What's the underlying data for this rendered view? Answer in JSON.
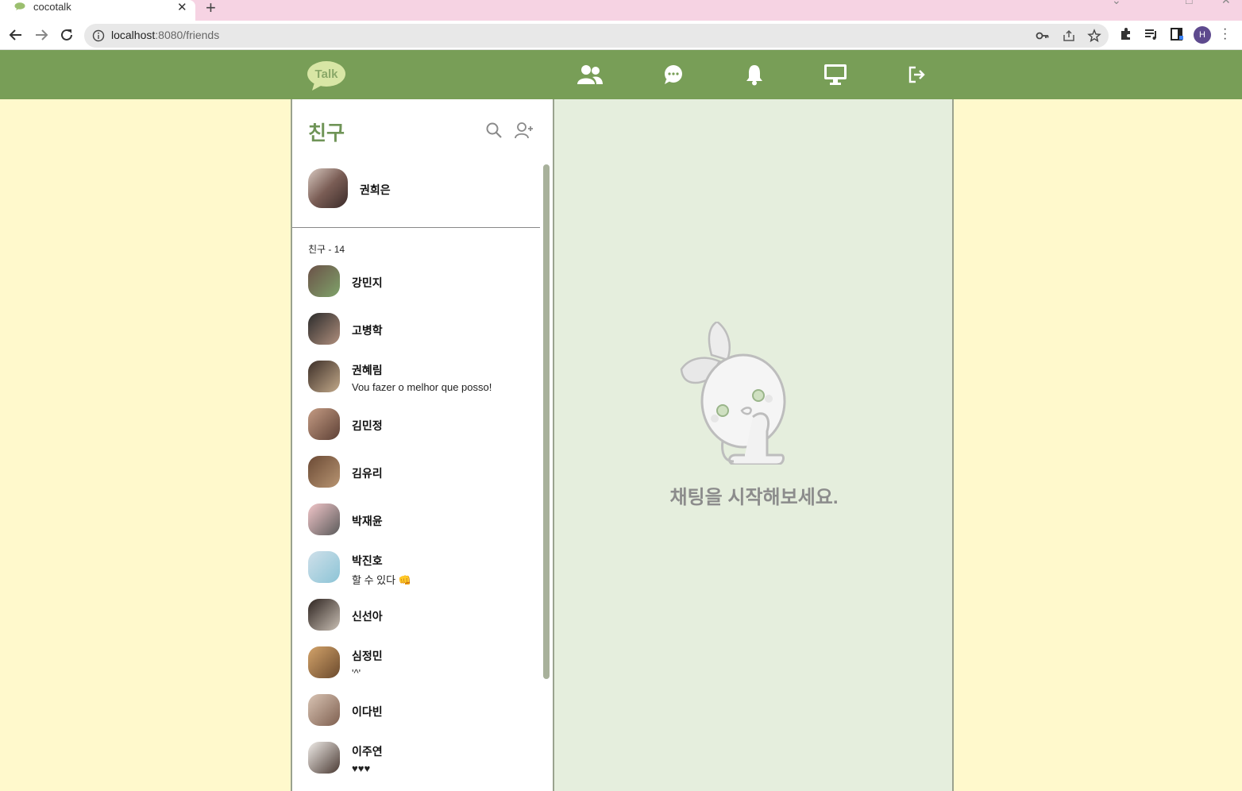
{
  "browser": {
    "tab_title": "cocotalk",
    "tab_close": "✕",
    "new_tab": "+",
    "url_host": "localhost",
    "url_rest": ":8080/friends",
    "profile_initial": "H"
  },
  "header": {
    "logo_text": "Talk",
    "nav": [
      "friends-icon",
      "chat-icon",
      "bell-icon",
      "monitor-icon",
      "logout-icon"
    ]
  },
  "friends": {
    "title": "친구",
    "my_profile": {
      "name": "권희은"
    },
    "count_label": "친구 - 14",
    "list": [
      {
        "name": "강민지",
        "status": "",
        "color1": "#6b5148",
        "color2": "#7fa36a"
      },
      {
        "name": "고병학",
        "status": "",
        "color1": "#2b2b2b",
        "color2": "#b08f7d"
      },
      {
        "name": "권혜림",
        "status": "Vou fazer o melhor que posso!",
        "color1": "#3d2f28",
        "color2": "#c2a98a"
      },
      {
        "name": "김민정",
        "status": "",
        "color1": "#c49b83",
        "color2": "#5d4035"
      },
      {
        "name": "김유리",
        "status": "",
        "color1": "#6b4a35",
        "color2": "#b89572"
      },
      {
        "name": "박재윤",
        "status": "",
        "color1": "#f2c6c9",
        "color2": "#5a5a5a"
      },
      {
        "name": "박진호",
        "status": "할 수 있다 👊",
        "color1": "#cfe0ea",
        "color2": "#8cc4d6"
      },
      {
        "name": "신선아",
        "status": "",
        "color1": "#2e2420",
        "color2": "#c9bfb4"
      },
      {
        "name": "심정민",
        "status": "'^'",
        "color1": "#d3a36a",
        "color2": "#6b4a2d"
      },
      {
        "name": "이다빈",
        "status": "",
        "color1": "#d9c4b4",
        "color2": "#7e5f4f"
      },
      {
        "name": "이주연",
        "status": "♥♥♥",
        "color1": "#f0ece8",
        "color2": "#4a3a33"
      }
    ]
  },
  "chat": {
    "empty_text": "채팅을 시작해보세요."
  },
  "colors": {
    "header_green": "#789e57",
    "page_bg": "#fff9cc",
    "chat_bg": "#e5eedd",
    "title_green": "#6f9457"
  }
}
